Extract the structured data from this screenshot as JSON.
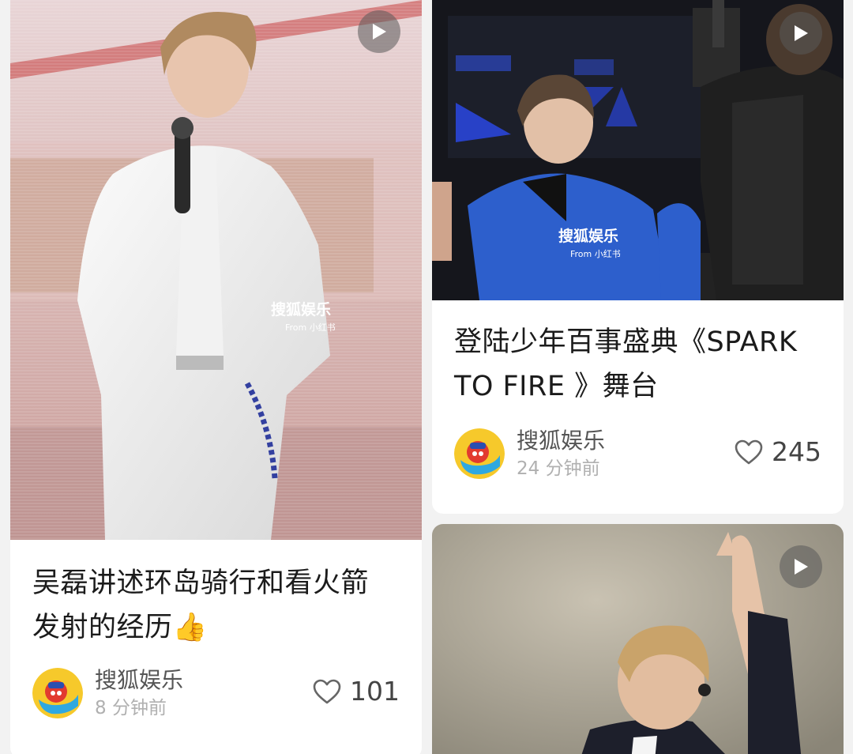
{
  "colors": {
    "background": "#f2f2f2",
    "card": "#ffffff",
    "title_text": "#1b1b1b",
    "author_text": "#555555",
    "time_text": "#b0b0b0"
  },
  "posts": [
    {
      "title": "吴磊讲述环岛骑行和看火箭\n发射的经历👍",
      "author": "搜狐娱乐",
      "time": "8 分钟前",
      "likes": "101",
      "thumbnail_watermark": "搜狐娱乐",
      "thumbnail_subtext": "From 小红书",
      "video": true
    },
    {
      "title": "登陆少年百事盛典《SPARK\nTO FIRE 》舞台",
      "author": "搜狐娱乐",
      "time": "24 分钟前",
      "likes": "245",
      "thumbnail_watermark": "搜狐娱乐",
      "thumbnail_subtext": "From 小红书",
      "video": true
    },
    {
      "video": true
    }
  ],
  "icons": {
    "play": "play-icon",
    "like": "heart-outline-icon",
    "avatar": "sohu-entertainment-logo"
  }
}
